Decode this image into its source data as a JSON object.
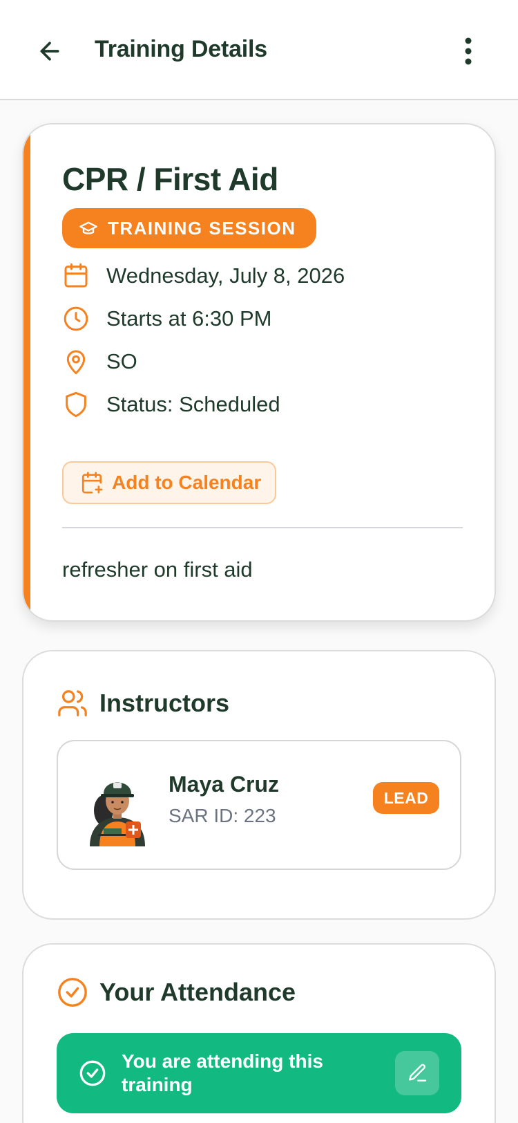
{
  "header": {
    "title": "Training Details",
    "back_icon": "arrow-left-icon",
    "menu_icon": "more-vertical-icon"
  },
  "event": {
    "title": "CPR / First Aid",
    "badge": "TRAINING SESSION",
    "badge_icon": "graduation-cap-icon",
    "date": "Wednesday, July 8, 2026",
    "time": "Starts at 6:30 PM",
    "location": "SO",
    "status": "Status: Scheduled",
    "add_calendar_label": "Add to Calendar",
    "description": "refresher on first aid"
  },
  "instructors": {
    "heading": "Instructors",
    "items": [
      {
        "name": "Maya Cruz",
        "sar_id": "SAR ID: 223",
        "role": "LEAD"
      }
    ]
  },
  "attendance": {
    "heading": "Your Attendance",
    "status_text": "You are attending this training"
  },
  "colors": {
    "accent": "#f6821f",
    "text": "#1f3a2b",
    "success": "#12b981",
    "muted": "#6b7280"
  }
}
